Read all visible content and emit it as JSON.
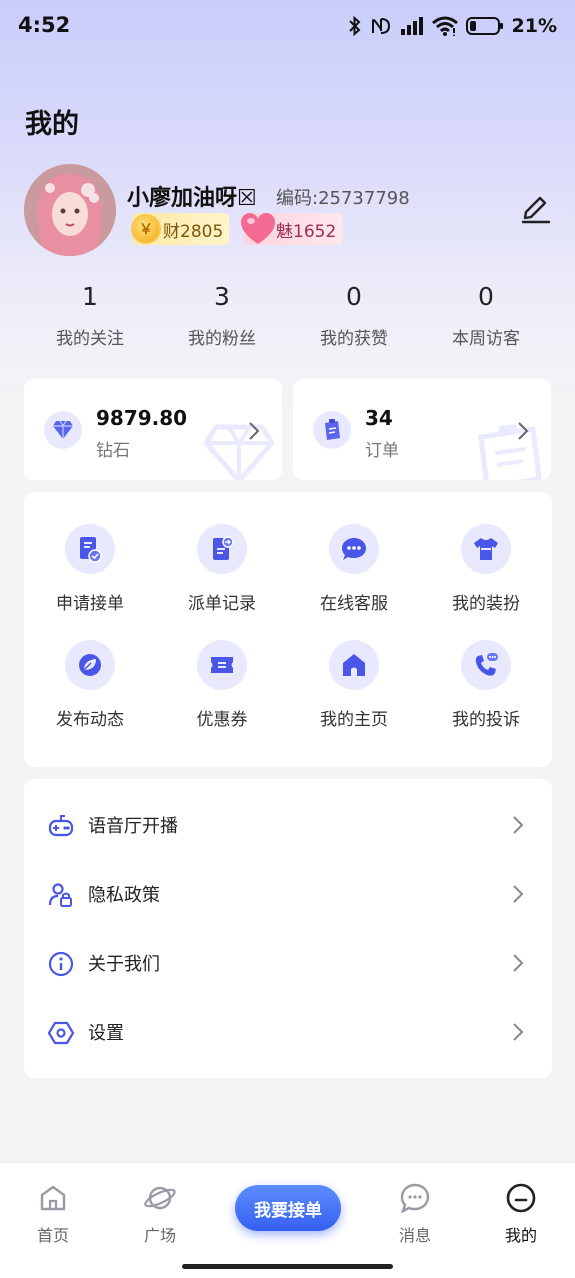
{
  "status_bar": {
    "time": "4:52",
    "battery": "21%"
  },
  "page_title": "我的",
  "profile": {
    "nickname": "小廖加油呀☒",
    "code": "编码:25737798",
    "wealth": "财2805",
    "charm": "魅1652"
  },
  "stats": [
    {
      "value": "1",
      "label": "我的关注"
    },
    {
      "value": "3",
      "label": "我的粉丝"
    },
    {
      "value": "0",
      "label": "我的获赞"
    },
    {
      "value": "0",
      "label": "本周访客"
    }
  ],
  "wallet": {
    "diamond": {
      "value": "9879.80",
      "label": "钻石"
    },
    "orders": {
      "value": "34",
      "label": "订单"
    }
  },
  "services": [
    {
      "label": "申请接单",
      "icon": "apply-order-icon"
    },
    {
      "label": "派单记录",
      "icon": "dispatch-record-icon"
    },
    {
      "label": "在线客服",
      "icon": "chat-support-icon"
    },
    {
      "label": "我的装扮",
      "icon": "tshirt-icon"
    },
    {
      "label": "发布动态",
      "icon": "leaf-post-icon"
    },
    {
      "label": "优惠券",
      "icon": "coupon-icon"
    },
    {
      "label": "我的主页",
      "icon": "home-icon"
    },
    {
      "label": "我的投诉",
      "icon": "phone-complaint-icon"
    }
  ],
  "menu": [
    {
      "label": "语音厅开播",
      "icon": "gamepad-icon"
    },
    {
      "label": "隐私政策",
      "icon": "user-lock-icon"
    },
    {
      "label": "关于我们",
      "icon": "info-icon"
    },
    {
      "label": "设置",
      "icon": "hexagon-settings-icon"
    }
  ],
  "tabbar": {
    "home": "首页",
    "square": "广场",
    "cta": "我要接单",
    "messages": "消息",
    "mine": "我的"
  },
  "colors": {
    "accent": "#4a6cf7",
    "icon_bg": "#e8e9ff"
  }
}
